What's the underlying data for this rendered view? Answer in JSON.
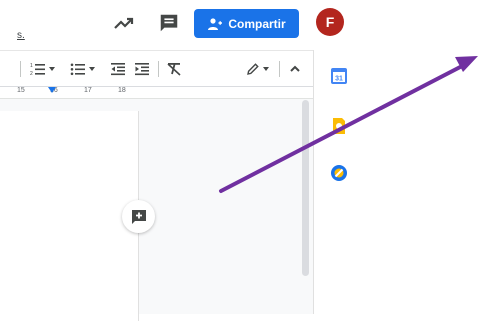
{
  "header": {
    "menu_fragment": "s.",
    "share_label": "Compartir",
    "avatar_initial": "F",
    "share_color": "#1a73e8",
    "avatar_color": "#b3261e"
  },
  "ruler": {
    "ticks": [
      "15",
      "16",
      "17",
      "18"
    ]
  },
  "icons": {
    "activity": "trending-up-icon",
    "comments": "comment-icon",
    "numbered_list": "numbered-list-icon",
    "bulleted_list": "bulleted-list-icon",
    "decrease_indent": "decrease-indent-icon",
    "increase_indent": "increase-indent-icon",
    "clear_formatting": "clear-formatting-icon",
    "editing_mode": "pencil-icon",
    "collapse": "chevron-up-icon",
    "add_comment": "add-comment-icon",
    "calendar": "calendar-icon",
    "keep": "keep-icon",
    "tasks": "tasks-icon"
  },
  "annotation": {
    "arrow_color": "#7030a0"
  }
}
